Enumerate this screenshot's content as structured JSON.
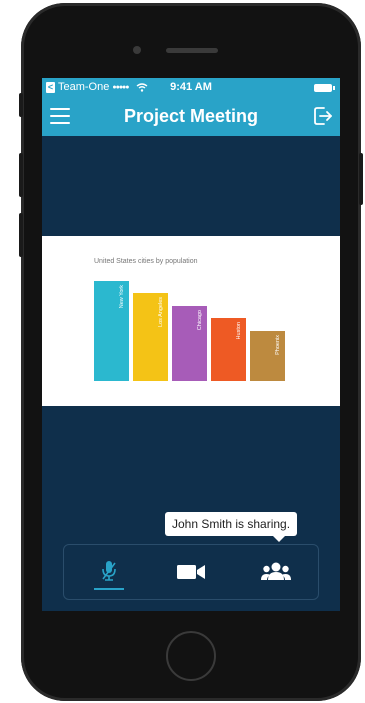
{
  "status_bar": {
    "carrier": "Team-One",
    "signal": "●●●●●",
    "time": "9:41 AM"
  },
  "nav": {
    "title": "Project Meeting"
  },
  "shared_content": {
    "chart_data": {
      "type": "bar",
      "title": "United States cities by population",
      "categories": [
        "New York",
        "Los Angeles",
        "Chicago",
        "Huston",
        "Phoenix"
      ],
      "values": [
        100,
        88,
        75,
        63,
        50
      ],
      "colors": [
        "#2bb8cf",
        "#f4c316",
        "#a75cb8",
        "#ee5a24",
        "#bd8a3f"
      ],
      "ylim": [
        0,
        100
      ]
    }
  },
  "sharing_tooltip": {
    "text": "John Smith is sharing."
  },
  "controls": {
    "accent": "#29a3c8",
    "items": [
      {
        "name": "microphone",
        "icon": "mic-icon"
      },
      {
        "name": "video",
        "icon": "video-camera-icon"
      },
      {
        "name": "participants",
        "icon": "group-icon"
      }
    ]
  },
  "theme": {
    "header_bg": "#29a3c8",
    "screen_bg": "#0f2f4b",
    "phone_body": "#121212"
  }
}
